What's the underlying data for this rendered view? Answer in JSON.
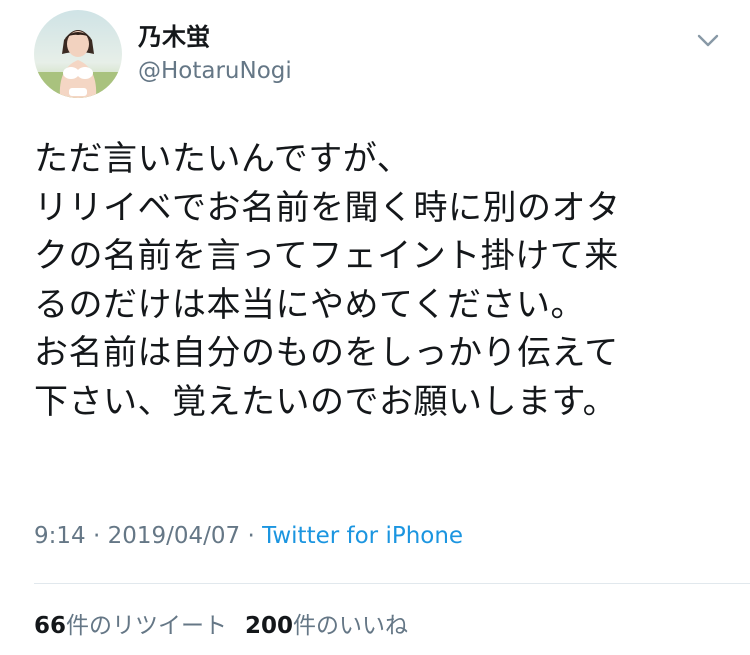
{
  "user": {
    "display_name": "乃木蛍",
    "handle": "@HotaruNogi"
  },
  "icons": {
    "avatar": "profile-photo",
    "more": "chevron-down-icon"
  },
  "tweet": {
    "lines": [
      "ただ言いたいんですが、",
      "リリイベでお名前を聞く時に別のオタ",
      "クの名前を言ってフェイント掛けて来",
      "るのだけは本当にやめてください。",
      "お名前は自分のものをしっかり伝えて",
      "下さい、覚えたいのでお願いします。"
    ]
  },
  "meta": {
    "time": "9:14",
    "separator1": " · ",
    "date": "2019/04/07",
    "separator2": " · ",
    "source": "Twitter for iPhone"
  },
  "stats": {
    "retweets_count": "66",
    "retweets_label": "件のリツイート",
    "likes_count": "200",
    "likes_label": "件のいいね"
  },
  "colors": {
    "text": "#14171a",
    "secondary": "#657786",
    "link": "#1b95e0",
    "divider": "#e1e8ed"
  }
}
